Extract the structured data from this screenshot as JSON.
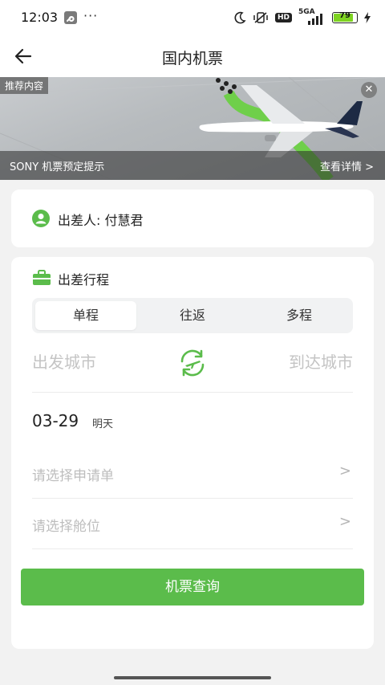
{
  "status_bar": {
    "time": "12:03",
    "more": "···",
    "network": "5GA",
    "hd": "HD",
    "battery": "79"
  },
  "header": {
    "title": "国内机票"
  },
  "banner": {
    "tag": "推荐内容",
    "caption": "SONY 机票预定提示",
    "link": "查看详情 >"
  },
  "traveler": {
    "label": "出差人: 付慧君"
  },
  "itinerary": {
    "heading": "出差行程",
    "tabs": [
      {
        "label": "单程",
        "active": true
      },
      {
        "label": "往返",
        "active": false
      },
      {
        "label": "多程",
        "active": false
      }
    ],
    "departure_placeholder": "出发城市",
    "arrival_placeholder": "到达城市",
    "date": "03-29",
    "date_note": "明天",
    "application_placeholder": "请选择申请单",
    "cabin_placeholder": "请选择舱位",
    "chevron": ">"
  },
  "search_button": {
    "label": "机票查询"
  },
  "colors": {
    "accent": "#5bbc4b",
    "placeholder": "#bdbdbd"
  }
}
